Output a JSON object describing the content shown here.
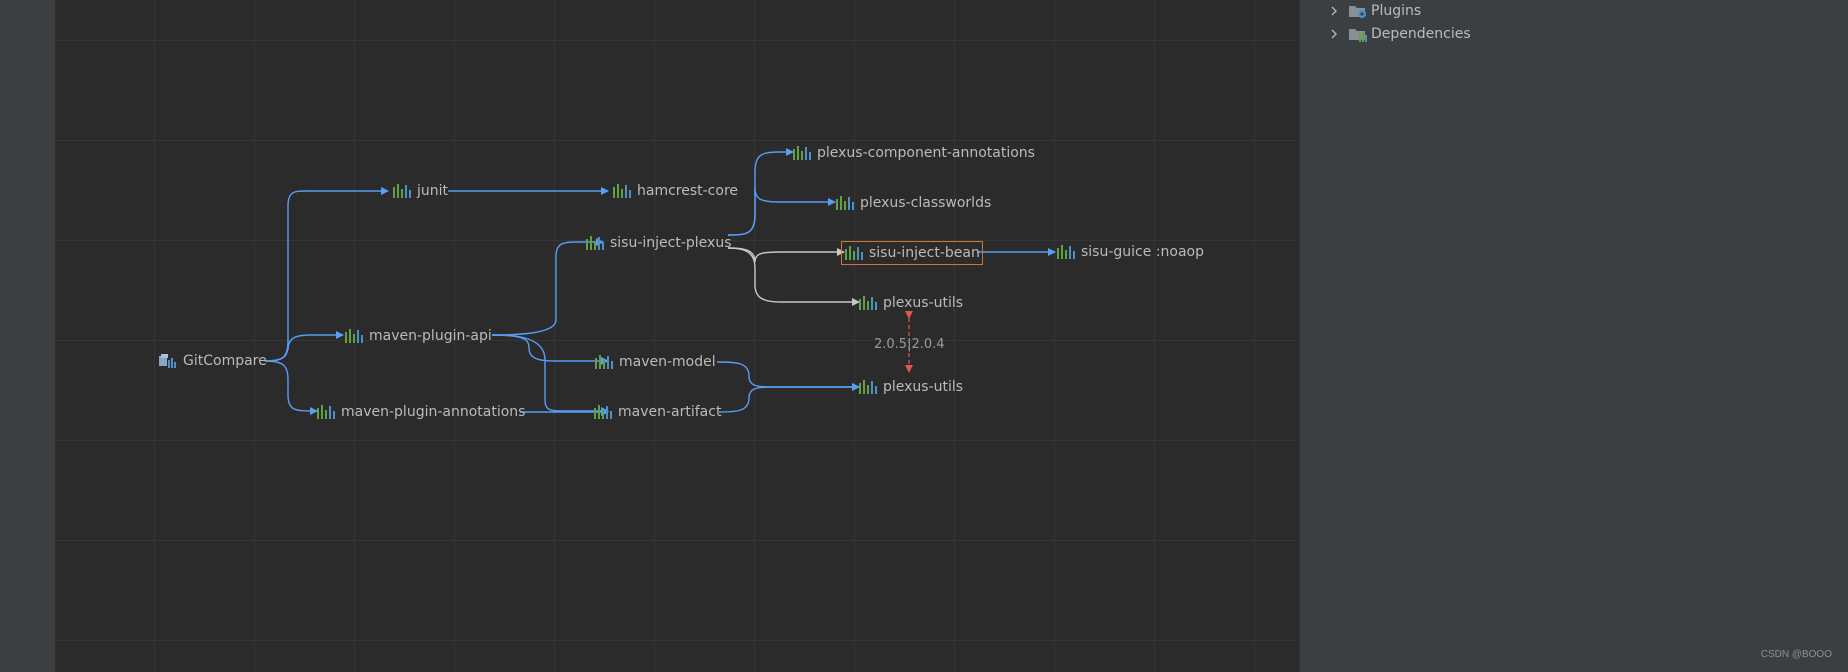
{
  "colors": {
    "edge_blue": "#589df6",
    "edge_gray": "#c8c8c8",
    "conflict_red": "#e05555",
    "selected_border": "#cc7832",
    "library_icon_green": "#62a046",
    "library_icon_blue": "#4e8fc4",
    "project_icon": "#8aa4c8",
    "folder_icon": "#8a8f94"
  },
  "graph": {
    "nodes": [
      {
        "id": "gitcompare",
        "label": "GitCompare",
        "icon": "maven-project-icon"
      },
      {
        "id": "junit",
        "label": "junit",
        "icon": "library-icon"
      },
      {
        "id": "hamcrest",
        "label": "hamcrest-core",
        "icon": "library-icon"
      },
      {
        "id": "plexus-ca",
        "label": "plexus-component-annotations",
        "icon": "library-icon"
      },
      {
        "id": "plexus-cw",
        "label": "plexus-classworlds",
        "icon": "library-icon"
      },
      {
        "id": "sisu-plexus",
        "label": "sisu-inject-plexus",
        "icon": "library-icon"
      },
      {
        "id": "sisu-bean",
        "label": "sisu-inject-bean",
        "icon": "library-icon",
        "selected": true
      },
      {
        "id": "sisu-guice",
        "label": "sisu-guice :noaop",
        "icon": "library-icon"
      },
      {
        "id": "plexus-utils-a",
        "label": "plexus-utils",
        "icon": "library-icon"
      },
      {
        "id": "mpa",
        "label": "maven-plugin-api",
        "icon": "library-icon"
      },
      {
        "id": "mmodel",
        "label": "maven-model",
        "icon": "library-icon"
      },
      {
        "id": "plexus-utils-b",
        "label": "plexus-utils",
        "icon": "library-icon"
      },
      {
        "id": "mpann",
        "label": "maven-plugin-annotations",
        "icon": "library-icon"
      },
      {
        "id": "martifact",
        "label": "maven-artifact",
        "icon": "library-icon"
      }
    ],
    "conflict_label": "2.0.5|2.0.4"
  },
  "tree": [
    {
      "label": "Plugins",
      "icon": "plugins-folder-icon"
    },
    {
      "label": "Dependencies",
      "icon": "dependencies-folder-icon"
    }
  ],
  "watermark": "CSDN @BOOO"
}
